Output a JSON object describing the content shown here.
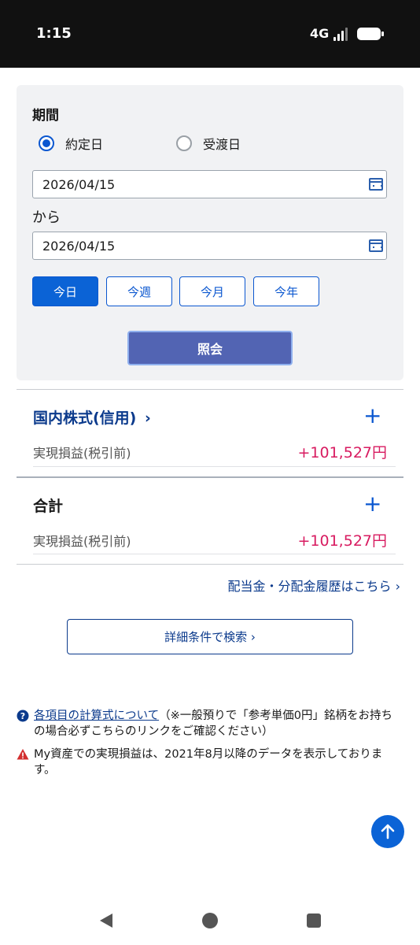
{
  "status": {
    "time": "1:15",
    "network": "4G"
  },
  "period": {
    "title": "期間",
    "radio_options": [
      {
        "label": "約定日",
        "checked": true
      },
      {
        "label": "受渡日",
        "checked": false
      }
    ],
    "from_date": "2026/04/15",
    "separator": "から",
    "to_date": "2026/04/15",
    "quick_buttons": [
      {
        "label": "今日",
        "active": true
      },
      {
        "label": "今週",
        "active": false
      },
      {
        "label": "今月",
        "active": false
      },
      {
        "label": "今年",
        "active": false
      }
    ],
    "search_label": "照会"
  },
  "sections": [
    {
      "title": "国内株式(信用)",
      "chevron": "›",
      "label": "実現損益(税引前)",
      "value": "+101,527円"
    },
    {
      "title": "合計",
      "label": "実現損益(税引前)",
      "value": "+101,527円"
    }
  ],
  "links": {
    "dividend": "配当金・分配金履歴はこちら ›",
    "detail_search": "詳細条件で検索 ›"
  },
  "notes": {
    "calc_link": "各項目の計算式について",
    "calc_text": "（※一般預りで「参考単価0円」銘柄をお持ちの場合必ずこちらのリンクをご確認ください）",
    "warning": "My資産での実現損益は、2021年8月以降のデータを表示しております。"
  },
  "colors": {
    "accent": "#0b57d0",
    "positive": "#d81b60",
    "search_button": "#5264b3"
  }
}
